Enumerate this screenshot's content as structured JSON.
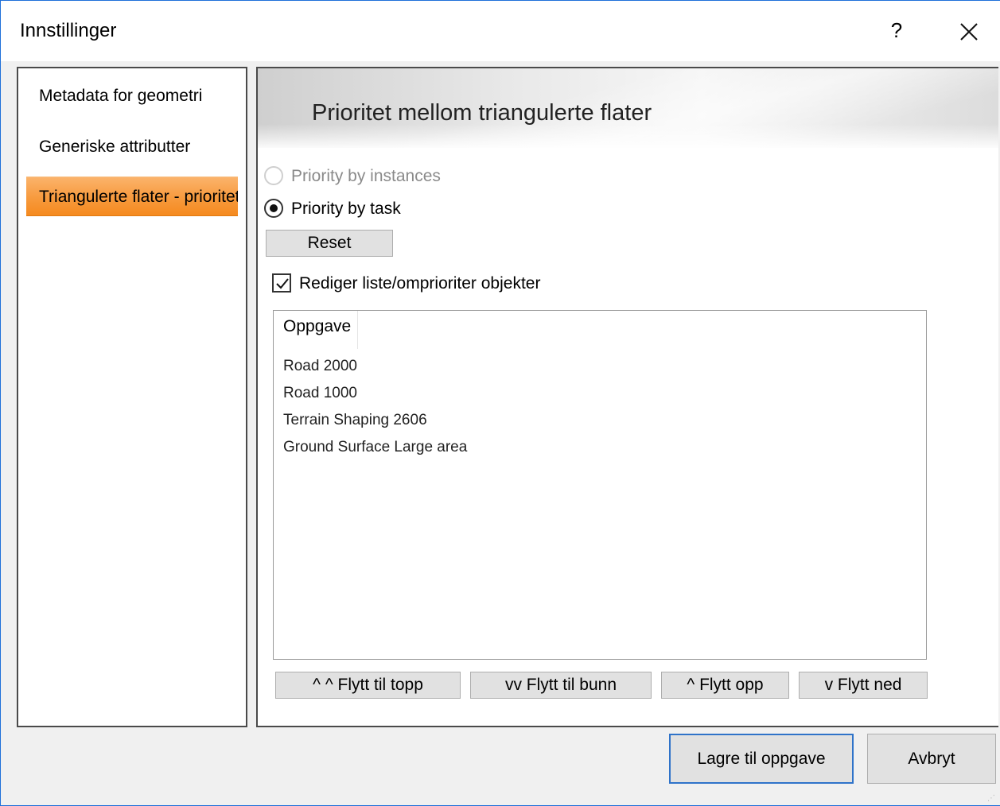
{
  "window": {
    "title": "Innstillinger",
    "help_label": "?"
  },
  "nav": {
    "items": [
      {
        "label": "Metadata for geometri"
      },
      {
        "label": "Generiske attributter"
      },
      {
        "label": "Triangulerte flater - prioritet"
      }
    ],
    "selected_index": 2
  },
  "content": {
    "header": "Prioritet mellom triangulerte flater",
    "priority_mode": {
      "options": [
        {
          "label": "Priority by instances",
          "enabled": false,
          "selected": false
        },
        {
          "label": "Priority by task",
          "enabled": true,
          "selected": true
        }
      ]
    },
    "reset_label": "Reset",
    "edit_checkbox": {
      "label": "Rediger liste/omprioriter objekter",
      "checked": true
    },
    "list": {
      "column_header": "Oppgave",
      "items": [
        "Road 2000",
        "Road 1000",
        "Terrain Shaping 2606",
        "Ground Surface Large area"
      ]
    },
    "move_buttons": {
      "top": "^ ^ Flytt til topp",
      "bottom": "vv Flytt til bunn",
      "up": "^ Flytt opp",
      "down": "v Flytt ned"
    }
  },
  "footer": {
    "save_label": "Lagre til oppgave",
    "cancel_label": "Avbryt"
  },
  "colors": {
    "accent_border": "#2f73c9",
    "selected_nav": "#f79a3d"
  }
}
